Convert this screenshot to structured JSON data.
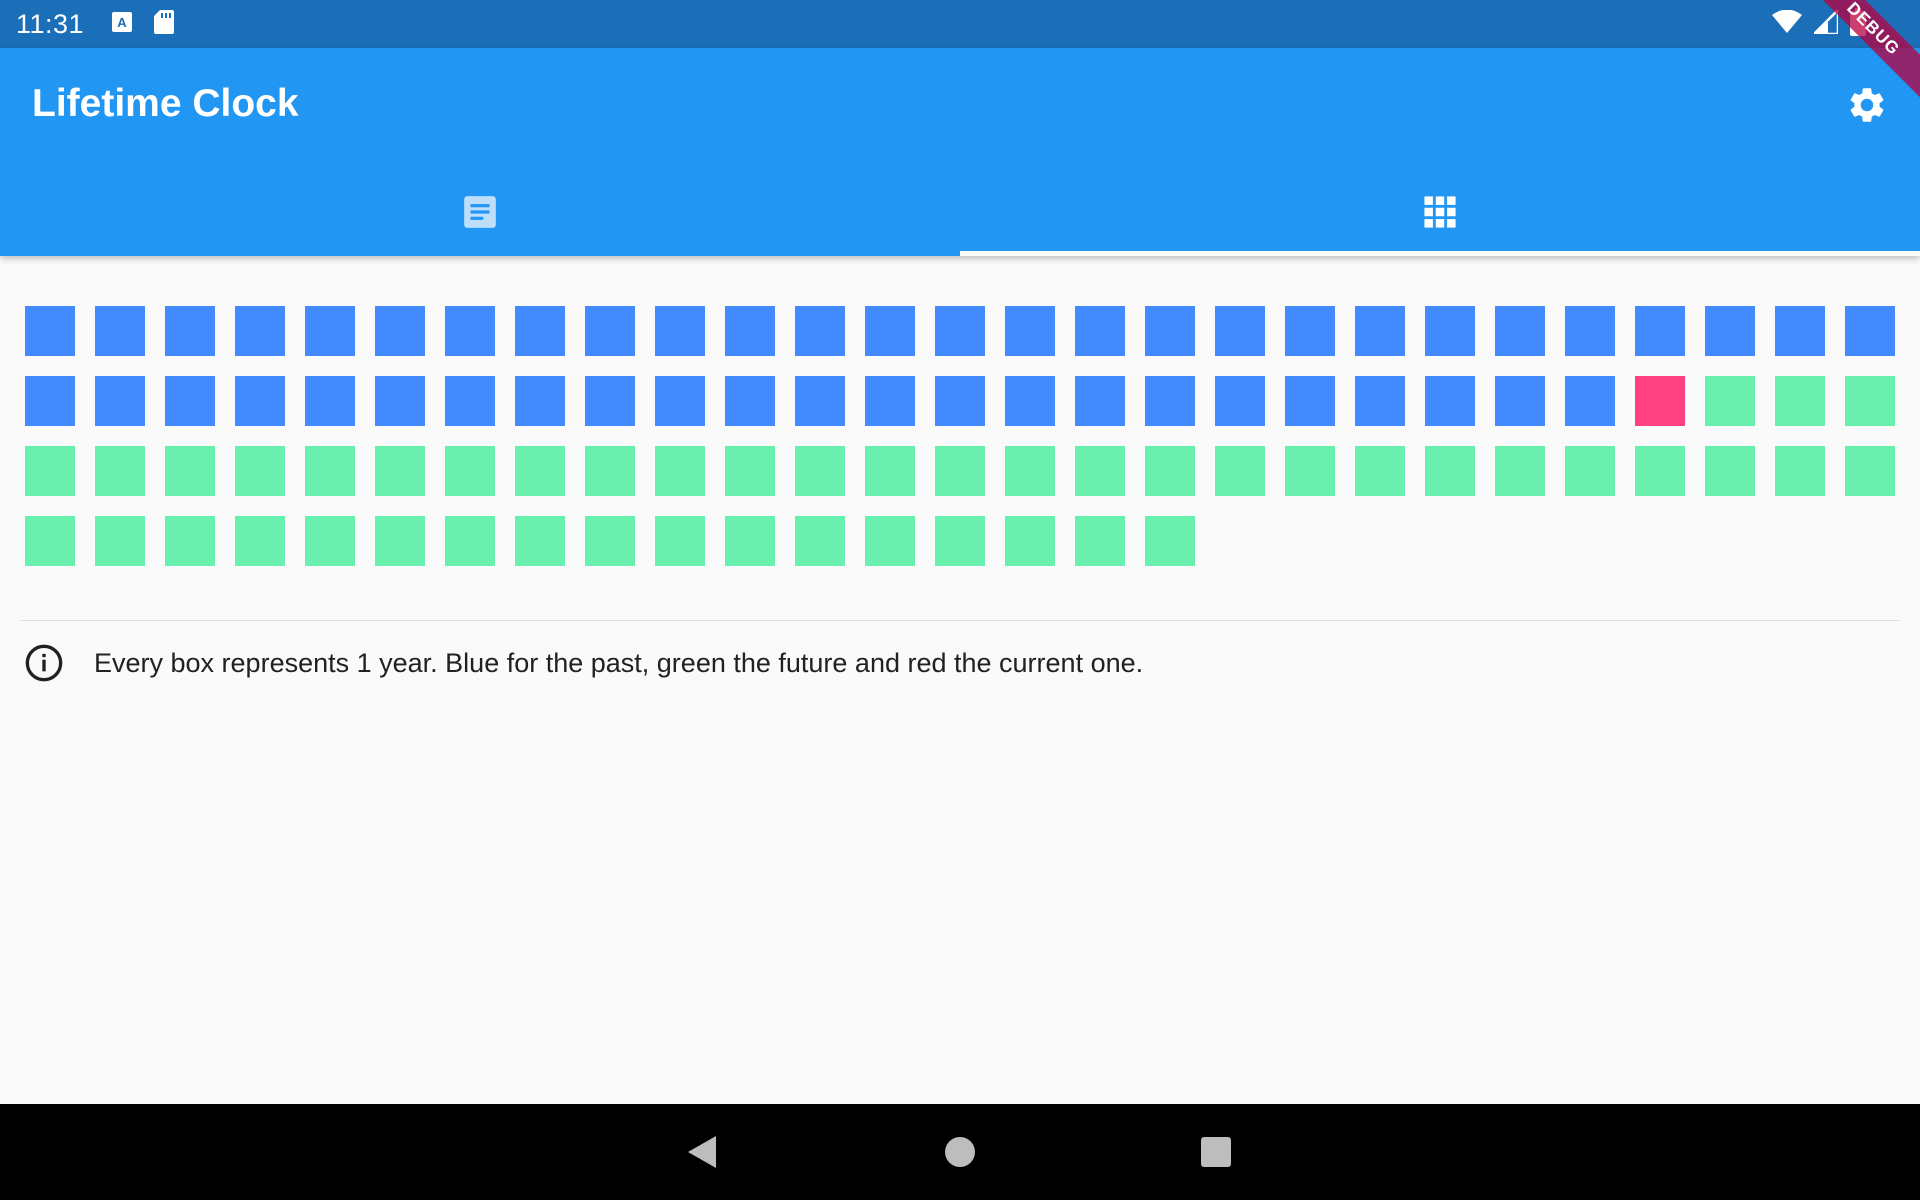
{
  "status_bar": {
    "time": "11:31",
    "notification_icons": [
      "accessibility-icon",
      "sd-card-icon"
    ],
    "right_icons": [
      "wifi-icon",
      "signal-icon",
      "battery-icon"
    ]
  },
  "debug_banner": "DEBUG",
  "app_bar": {
    "title": "Lifetime Clock",
    "action_icon": "gear-icon",
    "color": "#2196f3"
  },
  "tabs": [
    {
      "icon": "article-icon",
      "selected": false
    },
    {
      "icon": "grid-icon",
      "selected": true
    }
  ],
  "life_grid": {
    "past_count": 50,
    "current_count": 1,
    "future_count": 47,
    "colors": {
      "past": "#448aff",
      "current": "#ff4081",
      "future": "#69f0ae"
    }
  },
  "info": {
    "icon": "info-icon",
    "text": "Every box represents 1 year. Blue for the past, green the future and red the current one."
  },
  "nav_bar": {
    "buttons": [
      "back-icon",
      "home-icon",
      "recents-icon"
    ]
  }
}
